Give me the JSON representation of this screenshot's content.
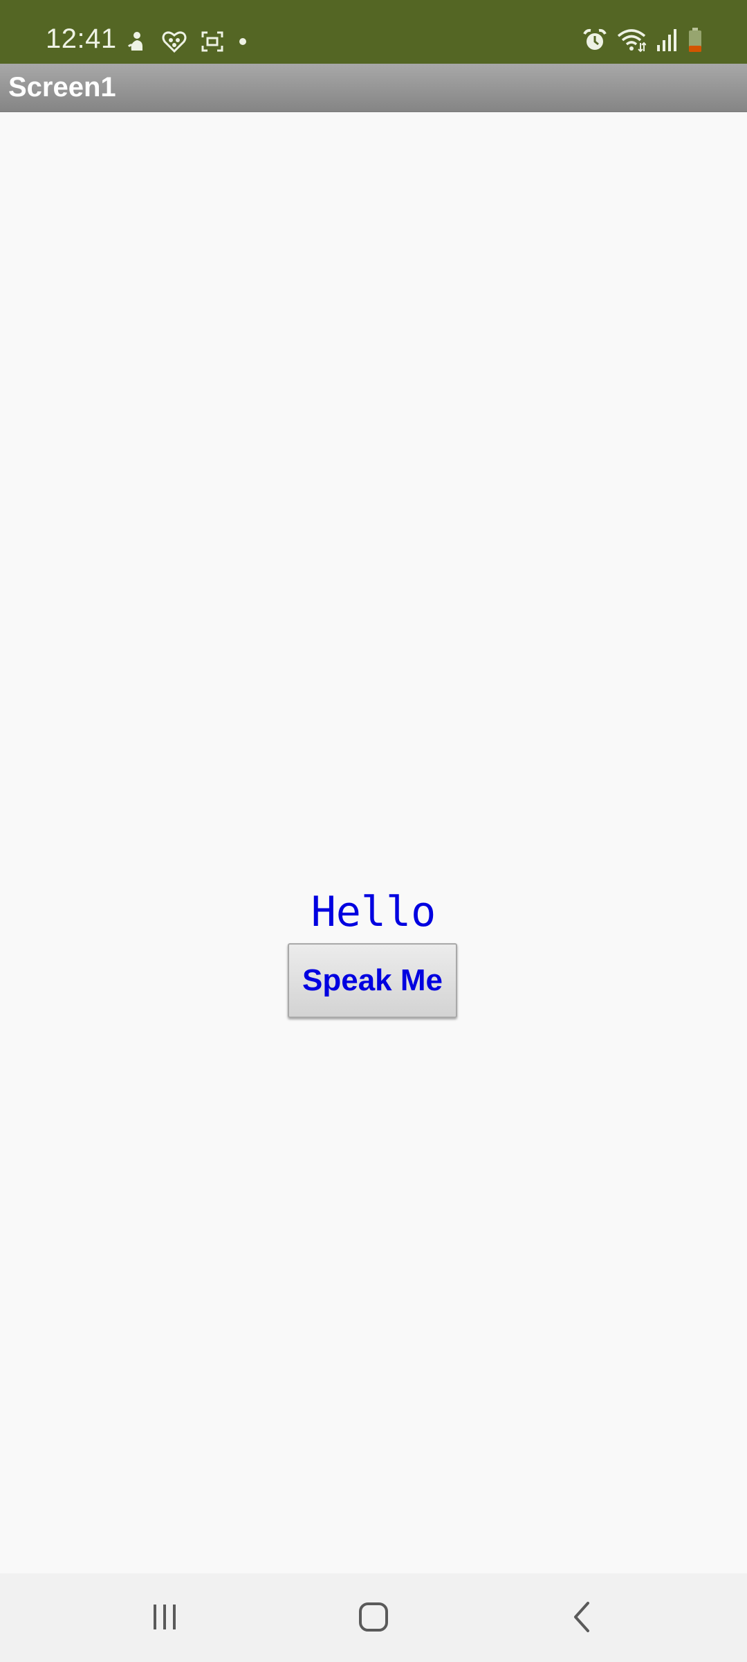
{
  "status_bar": {
    "time": "12:41",
    "left_icons": [
      "notification-person-icon",
      "notification-app-icon",
      "screenshot-icon",
      "dot-icon"
    ],
    "right_icons": [
      "alarm-icon",
      "wifi-icon",
      "signal-icon",
      "battery-icon"
    ],
    "background_color": "#546624",
    "battery_low_color": "#d35400"
  },
  "title_bar": {
    "title": "Screen1"
  },
  "main": {
    "label_text": "Hello",
    "button_label": "Speak Me",
    "text_color": "#0000e0"
  },
  "nav_bar": {
    "buttons": [
      "recent-apps-icon",
      "home-icon",
      "back-icon"
    ]
  }
}
